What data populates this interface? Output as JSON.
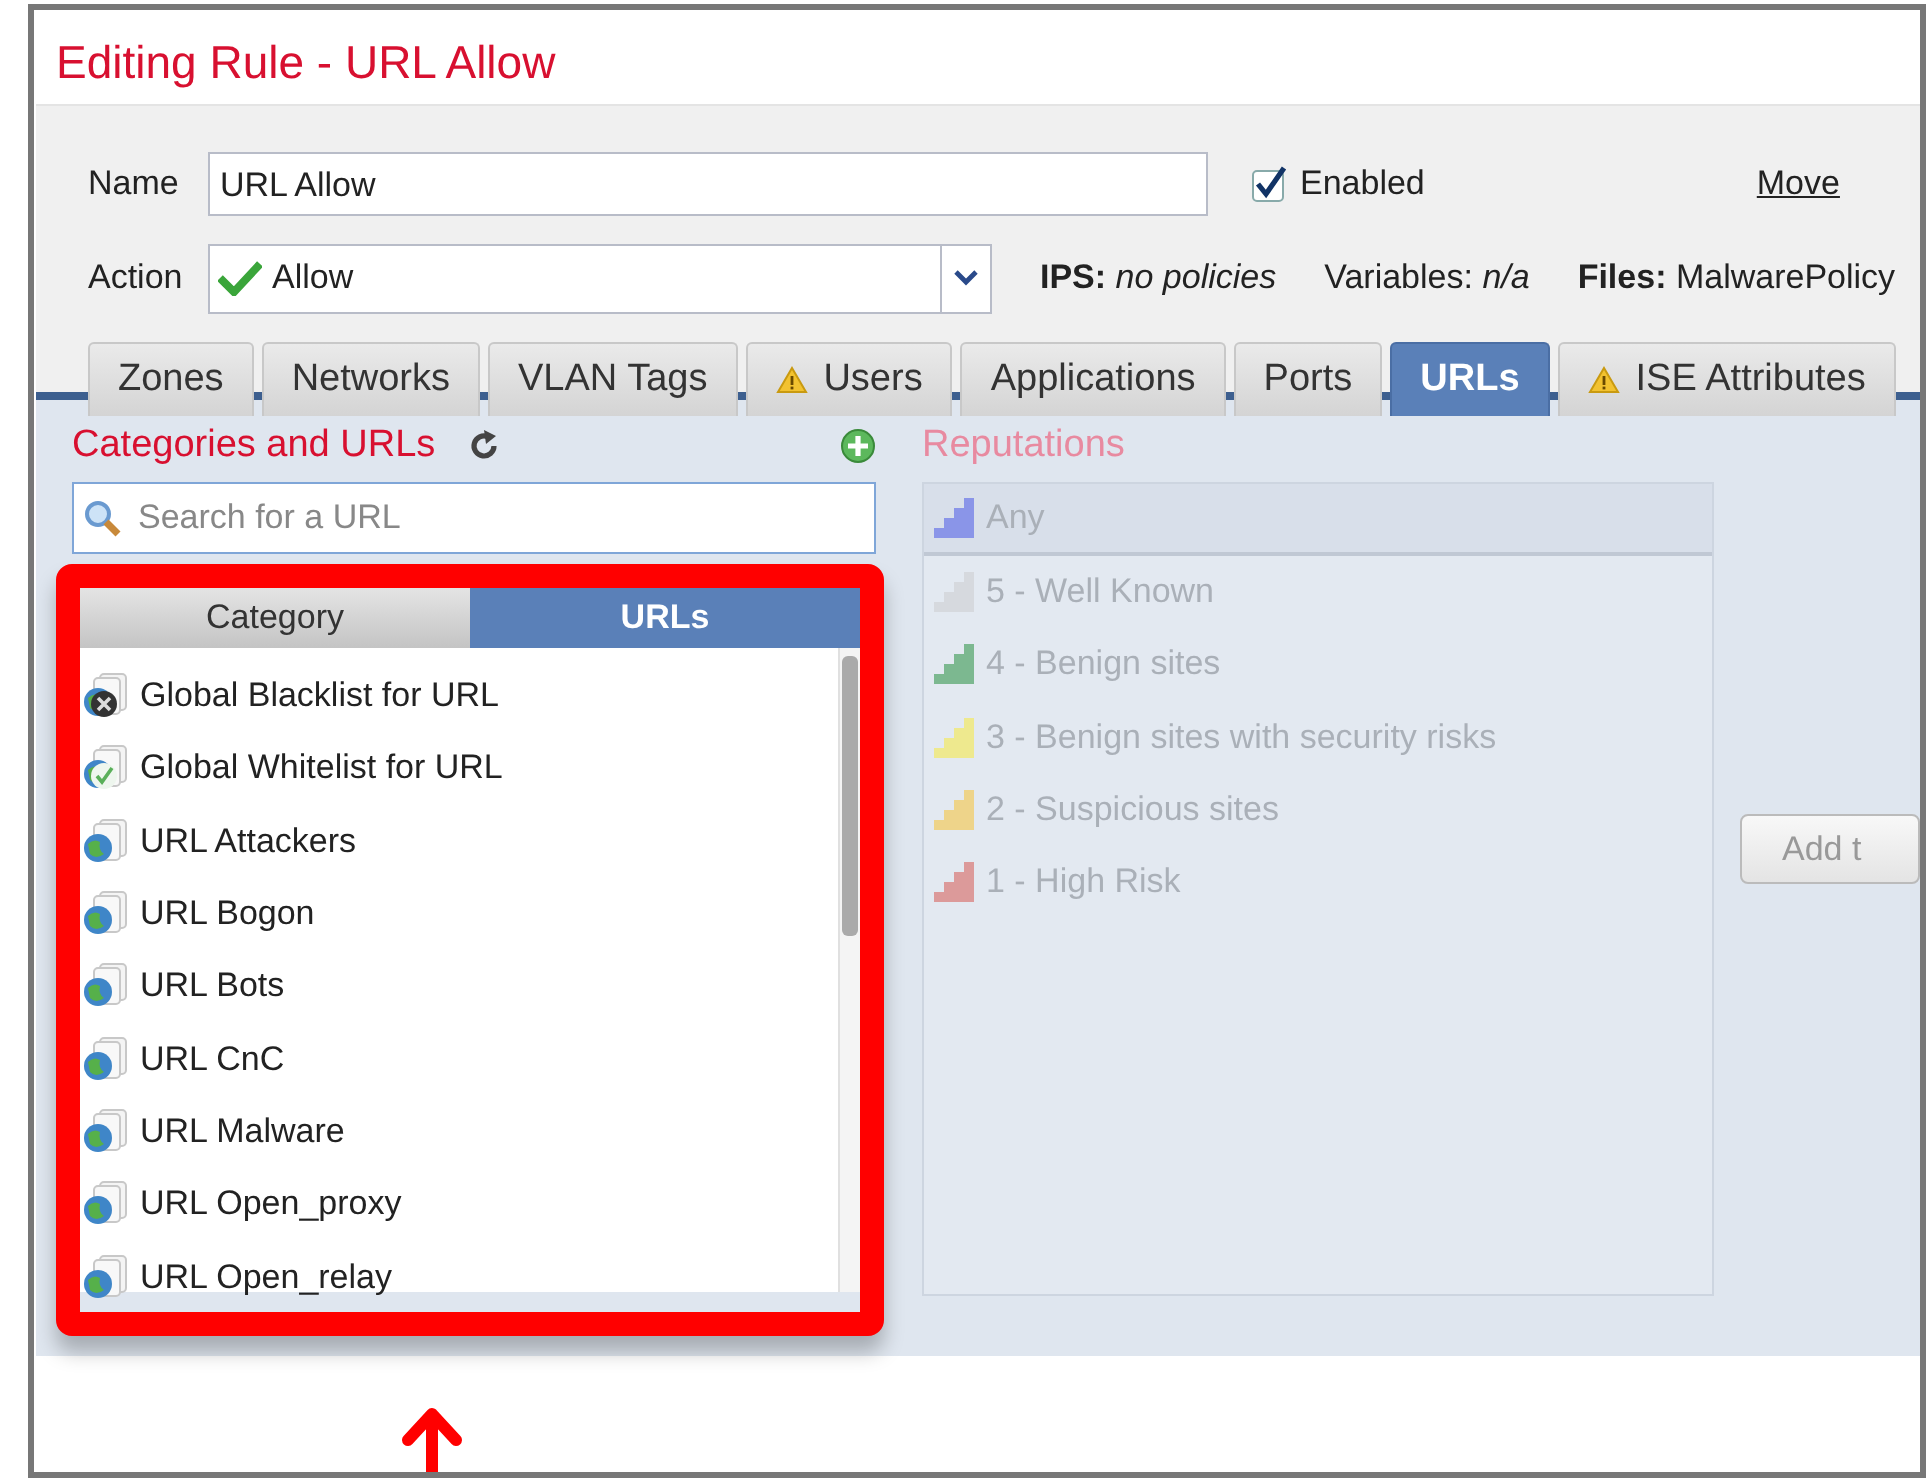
{
  "title": "Editing Rule - URL Allow",
  "form": {
    "name_label": "Name",
    "name_value": "URL Allow",
    "enabled": {
      "label": "Enabled",
      "checked": true
    },
    "move_link": "Move",
    "action_label": "Action",
    "action_value": "Allow",
    "info": [
      "**IPS:** *no policies*",
      "Variables: *n/a*",
      "**Files:** MalwarePolicy"
    ]
  },
  "tabs": [
    {
      "label": "Zones",
      "selected": false,
      "warning": false
    },
    {
      "label": "Networks",
      "selected": false,
      "warning": false
    },
    {
      "label": "VLAN Tags",
      "selected": false,
      "warning": false
    },
    {
      "label": "Users",
      "selected": false,
      "warning": true
    },
    {
      "label": "Applications",
      "selected": false,
      "warning": false
    },
    {
      "label": "Ports",
      "selected": false,
      "warning": false
    },
    {
      "label": "URLs",
      "selected": true,
      "warning": false
    },
    {
      "label": "ISE Attributes",
      "selected": false,
      "warning": true
    }
  ],
  "categories": {
    "title": "Categories and URLs",
    "search_placeholder": "Search for a URL",
    "subtabs": [
      {
        "label": "Category",
        "selected": false
      },
      {
        "label": "URLs",
        "selected": true
      }
    ],
    "items": [
      {
        "label": "Global Blacklist for URL",
        "kind": "blacklist"
      },
      {
        "label": "Global Whitelist for URL",
        "kind": "whitelist"
      },
      {
        "label": "URL Attackers",
        "kind": "globe"
      },
      {
        "label": "URL Bogon",
        "kind": "globe"
      },
      {
        "label": "URL Bots",
        "kind": "globe"
      },
      {
        "label": "URL CnC",
        "kind": "globe"
      },
      {
        "label": "URL Malware",
        "kind": "globe"
      },
      {
        "label": "URL Open_proxy",
        "kind": "globe"
      },
      {
        "label": "URL Open_relay",
        "kind": "globe"
      }
    ]
  },
  "reputations": {
    "title": "Reputations",
    "disabled": true,
    "items": [
      {
        "label": "Any",
        "selected": true,
        "color": "#8a95e8"
      },
      {
        "label": "5 - Well Known",
        "selected": false,
        "color": "#d6d9de"
      },
      {
        "label": "4 - Benign sites",
        "selected": false,
        "color": "#7cb890"
      },
      {
        "label": "3 - Benign sites with security risks",
        "selected": false,
        "color": "#eee98e"
      },
      {
        "label": "2 - Suspicious sites",
        "selected": false,
        "color": "#eed48a"
      },
      {
        "label": "1 - High Risk",
        "selected": false,
        "color": "#dc9a9a"
      }
    ]
  },
  "add_button": "Add t"
}
